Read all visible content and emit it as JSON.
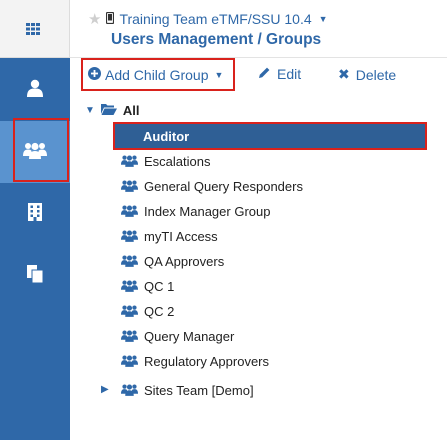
{
  "header": {
    "project": "Training Team eTMF/SSU 10.4",
    "title": "Users Management / Groups"
  },
  "toolbar": {
    "add_child_group": "Add Child Group",
    "edit": "Edit",
    "delete": "Delete"
  },
  "tree": {
    "root_label": "All",
    "items": [
      {
        "label": "Auditor",
        "selected": true
      },
      {
        "label": "Escalations"
      },
      {
        "label": "General Query Responders"
      },
      {
        "label": "Index Manager Group"
      },
      {
        "label": "myTI Access"
      },
      {
        "label": "QA Approvers"
      },
      {
        "label": "QC 1"
      },
      {
        "label": "QC 2"
      },
      {
        "label": "Query Manager"
      },
      {
        "label": "Regulatory Approvers"
      },
      {
        "label": "Sites Team [Demo]",
        "collapsed_children": true
      }
    ]
  },
  "rail": {
    "icons": [
      "grid-icon",
      "user-icon",
      "group-icon",
      "building-icon",
      "documents-icon"
    ],
    "selected": "group-icon"
  },
  "colors": {
    "brand_blue": "#2f68a8",
    "rail_selected": "#5a93cf",
    "tree_selected": "#2f5f95",
    "highlight_red": "#d9221c"
  }
}
